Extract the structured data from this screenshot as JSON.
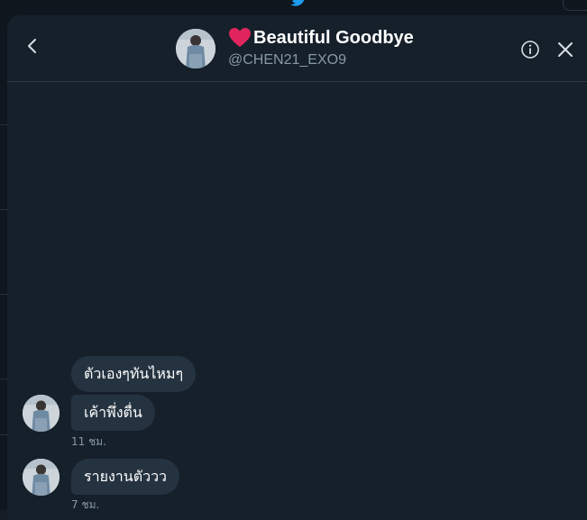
{
  "conversation": {
    "title": "Beautiful Goodbye",
    "handle": "@CHEN21_EXO9"
  },
  "colors": {
    "background": "#15202b",
    "bubble": "#253341",
    "muted_text": "#8899a6",
    "heart": "#e0245e"
  },
  "icons": {
    "back": "chevron-left-icon",
    "info": "info-icon",
    "close": "close-icon",
    "title_emoji": "heart-icon"
  },
  "messages": [
    {
      "text": "ตัวเองๆทันไหมๆ"
    },
    {
      "text": "เค้าพึ่งตื่น",
      "time": "11 ชม."
    },
    {
      "text": "รายงานตัววว",
      "time": "7 ชม."
    }
  ]
}
